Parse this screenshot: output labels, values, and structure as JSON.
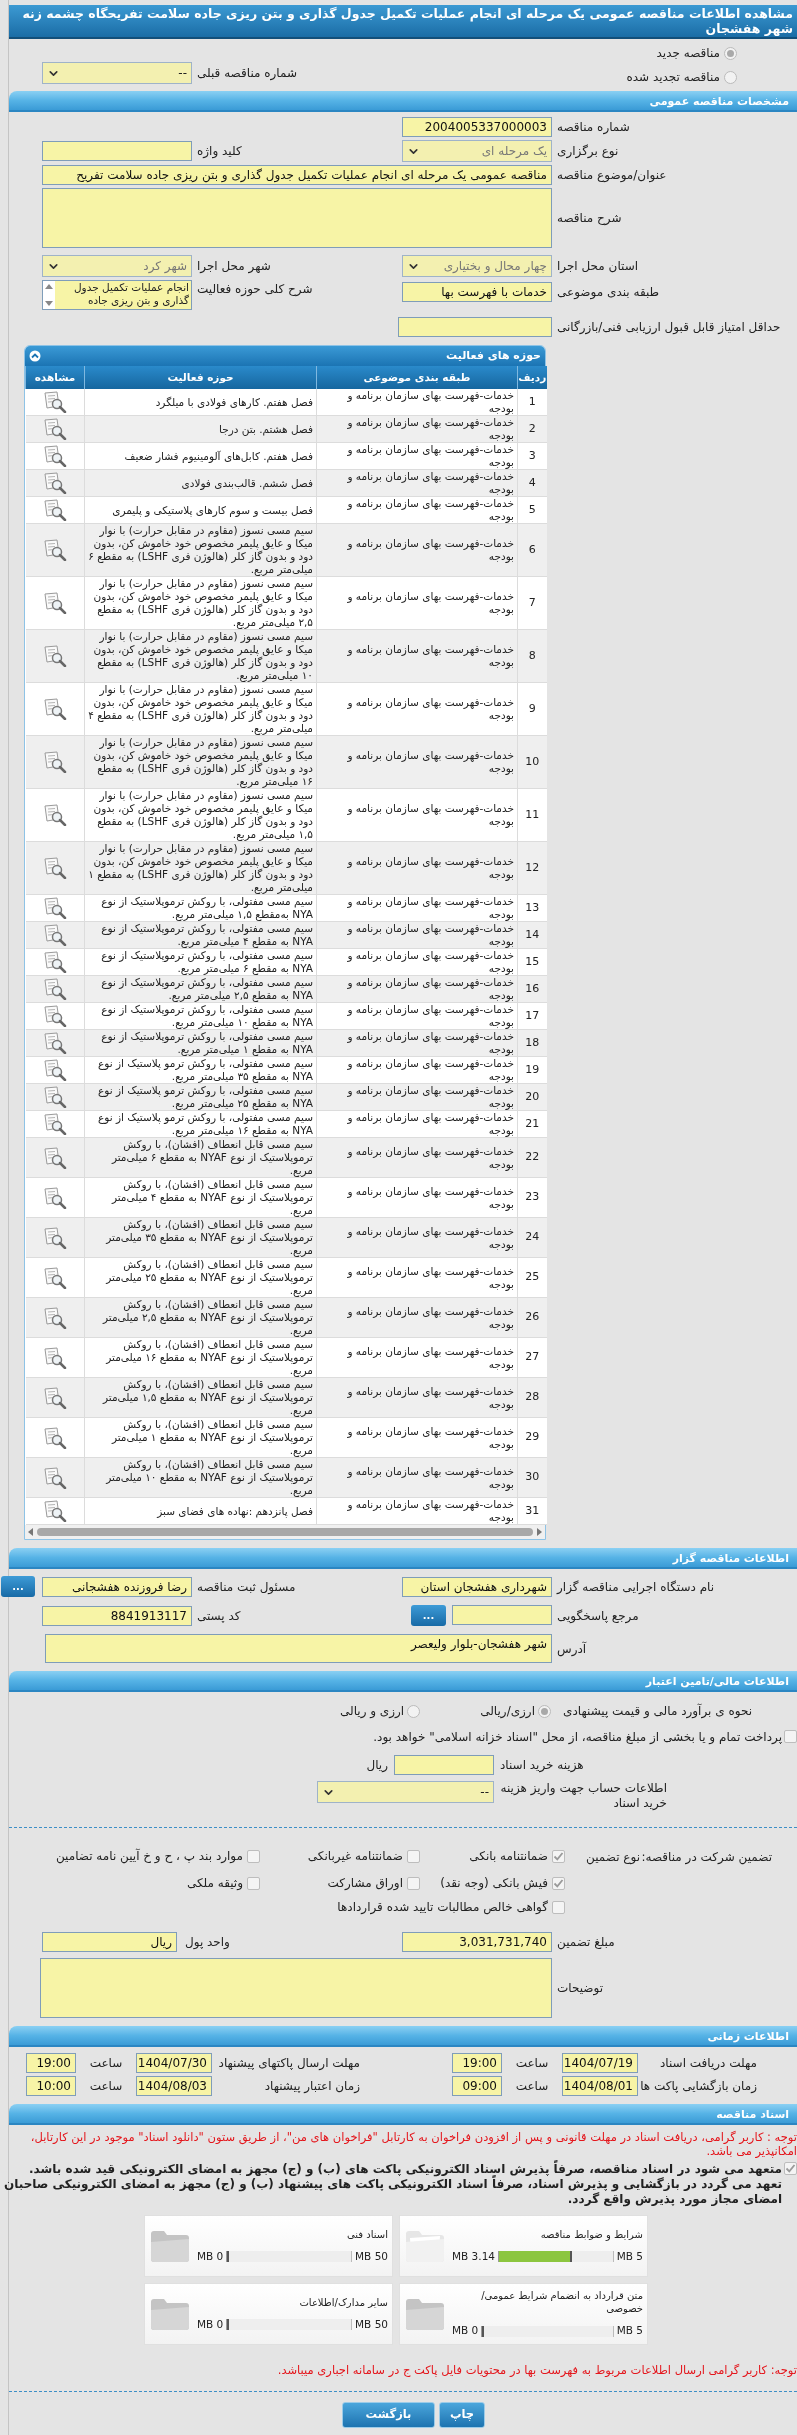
{
  "page_title": "مشاهده اطلاعات مناقصه عمومی یک مرحله ای انجام عملیات تکمیل جدول گذاری و بتن ریزی جاده سلامت تفریحگاه چشمه زنه شهر هفشجان",
  "tender_type": [
    {
      "label": "مناقصه جدید",
      "selected": true
    },
    {
      "label": "مناقصه تجدید شده",
      "selected": false
    }
  ],
  "previous_tender": {
    "label": "شماره مناقصه قبلی",
    "value": "--"
  },
  "general": {
    "header": "مشخصات مناقصه عمومی",
    "tender_number": {
      "label": "شماره مناقصه",
      "value": "2004005337000003"
    },
    "holding_type": {
      "label": "نوع برگزاری",
      "value": "یک مرحله ای",
      "disabled": true
    },
    "keyword": {
      "label": "کلید واژه"
    },
    "subject": {
      "label": "عنوان/موضوع مناقصه",
      "value": "مناقصه عمومی یک مرحله ای انجام عملیات تکمیل جدول گذاری و بتن ریزی جاده سلامت تفریح"
    },
    "description": {
      "label": "شرح مناقصه"
    },
    "province": {
      "label": "استان محل اجرا",
      "value": "چهار محال و بختیاری",
      "disabled": true
    },
    "city": {
      "label": "شهر محل اجرا",
      "value": "شهر کرد",
      "disabled": true
    },
    "category": {
      "label": "طبقه بندی موضوعی",
      "value": "خدمات با فهرست بها"
    },
    "activity_summary": {
      "label": "شرح کلی حوزه فعالیت",
      "value": "انجام عملیات تکمیل جدول گذاری و بتن ریزی جاده"
    },
    "min_score": {
      "label": "حداقل امتیاز قابل قبول ارزیابی فنی/بازرگانی"
    }
  },
  "activities": {
    "title": "حوزه های فعالیت",
    "columns": [
      "ردیف",
      "طبقه بندی موضوعی",
      "حوزه فعالیت",
      "مشاهده"
    ],
    "rows": [
      {
        "index": "1",
        "category": "خدمات-فهرست بهای سازمان برنامه و بودجه",
        "activity": "فصل هفتم. کارهای فولادی با میلگرد"
      },
      {
        "index": "2",
        "category": "خدمات-فهرست بهای سازمان برنامه و بودجه",
        "activity": "فصل هشتم. بتن درجا"
      },
      {
        "index": "3",
        "category": "خدمات-فهرست بهای سازمان برنامه و بودجه",
        "activity": "فصل هفتم. کابل‌های آلومینیوم فشار ضعیف"
      },
      {
        "index": "4",
        "category": "خدمات-فهرست بهای سازمان برنامه و بودجه",
        "activity": "فصل ششم. قالب‌بندی فولادی"
      },
      {
        "index": "5",
        "category": "خدمات-فهرست بهای سازمان برنامه و بودجه",
        "activity": "فصل بیست و سوم کارهای پلاستیکی و پلیمری"
      },
      {
        "index": "6",
        "category": "خدمات-فهرست بهای سازمان برنامه و بودجه",
        "activity": "سیم مسی نسوز (مقاوم در مقابل حرارت) با نوار میکا و عایق پلیمر مخصوص خود خاموش کن، بدون دود و بدون گاز کلر (هالوژن فری LSHF) به مقطع ۶ میلی‌متر مربع."
      },
      {
        "index": "7",
        "category": "خدمات-فهرست بهای سازمان برنامه و بودجه",
        "activity": "سیم مسی نسوز (مقاوم در مقابل حرارت) با نوار میکا و عایق پلیمر مخصوص خود خاموش کن، بدون دود و بدون گاز کلر (هالوژن فری LSHF) به مقطع ۲,۵ میلی‌متر مربع."
      },
      {
        "index": "8",
        "category": "خدمات-فهرست بهای سازمان برنامه و بودجه",
        "activity": "سیم مسی نسوز (مقاوم در مقابل حرارت) با نوار میکا و عایق پلیمر مخصوص خود خاموش کن، بدون دود و بدون گاز کلر (هالوژن فری LSHF) به مقطع ۱۰ میلی‌متر مربع."
      },
      {
        "index": "9",
        "category": "خدمات-فهرست بهای سازمان برنامه و بودجه",
        "activity": "سیم مسی نسوز (مقاوم در مقابل حرارت) با نوار میکا و عایق پلیمر مخصوص خود خاموش کن، بدون دود و بدون گاز کلر (هالوژن فری LSHF) به مقطع ۴ میلی‌متر مربع."
      },
      {
        "index": "10",
        "category": "خدمات-فهرست بهای سازمان برنامه و بودجه",
        "activity": "سیم مسی نسوز (مقاوم در مقابل حرارت) با نوار میکا و عایق پلیمر مخصوص خود خاموش کن، بدون دود و بدون گاز کلر (هالوژن فری LSHF) به مقطع ۱۶ میلی‌متر مربع."
      },
      {
        "index": "11",
        "category": "خدمات-فهرست بهای سازمان برنامه و بودجه",
        "activity": "سیم مسی نسوز (مقاوم در مقابل حرارت) با نوار میکا و عایق پلیمر مخصوص خود خاموش کن، بدون دود و بدون گاز کلر (هالوژن فری LSHF) به مقطع ۱,۵ میلی‌متر مربع."
      },
      {
        "index": "12",
        "category": "خدمات-فهرست بهای سازمان برنامه و بودجه",
        "activity": "سیم مسی نسوز (مقاوم در مقابل حرارت) با نوار میکا و عایق پلیمر مخصوص خود خاموش کن، بدون دود و بدون گاز کلر (هالوژن فری LSHF) به مقطع ۱ میلی‌متر مربع."
      },
      {
        "index": "13",
        "category": "خدمات-فهرست بهای سازمان برنامه و بودجه",
        "activity": "سیم مسی مفتولی، با روکش ترموپلاستیک از نوع NYA به‌مقطع ۱,۵ میلی‌متر مربع."
      },
      {
        "index": "14",
        "category": "خدمات-فهرست بهای سازمان برنامه و بودجه",
        "activity": "سیم مسی مفتولی، با روکش ترموپلاستیک از نوع NYA به مقطع ۴ میلی‌متر مربع."
      },
      {
        "index": "15",
        "category": "خدمات-فهرست بهای سازمان برنامه و بودجه",
        "activity": "سیم مسی مفتولی، با روکش ترموپلاستیک از نوع NYA به مقطع ۶ میلی‌متر مربع."
      },
      {
        "index": "16",
        "category": "خدمات-فهرست بهای سازمان برنامه و بودجه",
        "activity": "سیم مسی مفتولی، با روکش ترموپلاستیک از نوع NYA به مقطع ۲,۵ میلی‌متر مربع."
      },
      {
        "index": "17",
        "category": "خدمات-فهرست بهای سازمان برنامه و بودجه",
        "activity": "سیم مسی مفتولی، با روکش ترموپلاستیک از نوع NYA به مقطع ۱۰ میلی‌متر مربع."
      },
      {
        "index": "18",
        "category": "خدمات-فهرست بهای سازمان برنامه و بودجه",
        "activity": "سیم مسی مفتولی، با روکش ترموپلاستیک از نوع NYA به مقطع ۱ میلی‌متر مربع."
      },
      {
        "index": "19",
        "category": "خدمات-فهرست بهای سازمان برنامه و بودجه",
        "activity": "سیم مسی مفتولی، با روکش ترمو پلاستیک از نوع NYA به مقطع ۳۵ میلی‌متر مربع."
      },
      {
        "index": "20",
        "category": "خدمات-فهرست بهای سازمان برنامه و بودجه",
        "activity": "سیم مسی مفتولی، با روکش ترمو پلاستیک از نوع NYA به مقطع ۲۵ میلی‌متر مربع."
      },
      {
        "index": "21",
        "category": "خدمات-فهرست بهای سازمان برنامه و بودجه",
        "activity": "سیم مسی مفتولی، با روکش ترمو پلاستیک از نوع NYA به مقطع ۱۶ میلی‌متر مربع."
      },
      {
        "index": "22",
        "category": "خدمات-فهرست بهای سازمان برنامه و بودجه",
        "activity": "سیم مسی قابل انعطاف (افشان)، با روکش ترموپلاستیک از نوع NYAF به مقطع ۶ میلی‌متر مربع."
      },
      {
        "index": "23",
        "category": "خدمات-فهرست بهای سازمان برنامه و بودجه",
        "activity": "سیم مسی قابل انعطاف (افشان)، با روکش ترموپلاستیک از نوع NYAF به مقطع ۴ میلی‌متر مربع."
      },
      {
        "index": "24",
        "category": "خدمات-فهرست بهای سازمان برنامه و بودجه",
        "activity": "سیم مسی قابل انعطاف (افشان)، با روکش ترموپلاستیک از نوع NYAF به مقطع ۳۵ میلی‌متر مربع."
      },
      {
        "index": "25",
        "category": "خدمات-فهرست بهای سازمان برنامه و بودجه",
        "activity": "سیم مسی قابل انعطاف (افشان)، با روکش ترموپلاستیک از نوع NYAF به مقطع ۲۵ میلی‌متر مربع."
      },
      {
        "index": "26",
        "category": "خدمات-فهرست بهای سازمان برنامه و بودجه",
        "activity": "سیم مسی قابل انعطاف (افشان)، با روکش ترموپلاستیک از نوع NYAF به مقطع ۲,۵ میلی‌متر مربع."
      },
      {
        "index": "27",
        "category": "خدمات-فهرست بهای سازمان برنامه و بودجه",
        "activity": "سیم مسی قابل انعطاف (افشان)، با روکش ترموپلاستیک از نوع NYAF به مقطع ۱۶ میلی‌متر مربع."
      },
      {
        "index": "28",
        "category": "خدمات-فهرست بهای سازمان برنامه و بودجه",
        "activity": "سیم مسی قابل انعطاف (افشان)، با روکش ترموپلاستیک از نوع NYAF به مقطع ۱,۵ میلی‌متر مربع."
      },
      {
        "index": "29",
        "category": "خدمات-فهرست بهای سازمان برنامه و بودجه",
        "activity": "سیم مسی قابل انعطاف (افشان)، با روکش ترموپلاستیک از نوع NYAF به مقطع ۱ میلی‌متر مربع."
      },
      {
        "index": "30",
        "category": "خدمات-فهرست بهای سازمان برنامه و بودجه",
        "activity": "سیم مسی قابل انعطاف (افشان)، با روکش ترموپلاستیک از نوع NYAF به مقطع ۱۰ میلی‌متر مربع."
      },
      {
        "index": "31",
        "category": "خدمات-فهرست بهای سازمان برنامه و بودجه",
        "activity": "فصل پانزدهم :نهاده های فضای سبز"
      }
    ]
  },
  "organizer": {
    "header": "اطلاعات مناقصه گزار",
    "agency": {
      "label": "نام دستگاه اجرایی مناقصه گزار",
      "value": "شهرداری هفشجان استان"
    },
    "registrar": {
      "label": "مسئول ثبت مناقصه",
      "value": "رضا فروزنده هفشجانی",
      "button": "..."
    },
    "response_ref": {
      "label": "مرجع پاسخگویی",
      "button": "..."
    },
    "postal_code": {
      "label": "کد پستی",
      "value": "8841913117"
    },
    "address": {
      "label": "آدرس",
      "value": "شهر هفشجان-بلوار ولیعصر"
    }
  },
  "finance": {
    "header": "اطلاعات مالی/تامین اعتبار",
    "pricing": {
      "label": "نحوه ی برآورد مالی و قیمت پیشنهادی",
      "options": [
        {
          "label": "ارزی/ریالی",
          "selected": true
        },
        {
          "label": "ارزی و ریالی",
          "selected": false
        }
      ]
    },
    "treasury": {
      "label": "پرداخت تمام و یا بخشی از مبلغ مناقصه، از محل \"اسناد خزانه اسلامی\" خواهد بود.",
      "checked": false
    },
    "doc_fee": {
      "label": "هزینه خرید اسناد",
      "unit": "ریال"
    },
    "account": {
      "label": "اطلاعات حساب جهت واریز هزینه خرید اسناد",
      "value": "--"
    },
    "guarantee": {
      "label": "تضمین شرکت در مناقصه:",
      "type_label": "نوع تضمین",
      "options": [
        {
          "label": "ضمانتنامه بانکی",
          "checked": true
        },
        {
          "label": "ضمانتنامه غیربانکی",
          "checked": false
        },
        {
          "label": "موارد بند پ ، ح و خ آیین نامه تضامین",
          "checked": false
        },
        {
          "label": "فیش بانکی (وجه نقد)",
          "checked": true
        },
        {
          "label": "اوراق مشارکت",
          "checked": false
        },
        {
          "label": "وثیقه ملکی",
          "checked": false
        },
        {
          "label": "گواهی خالص مطالبات تایید شده قراردادها",
          "checked": false
        }
      ]
    },
    "amount": {
      "label": "مبلغ تضمین",
      "value": "3,031,731,740"
    },
    "currency": {
      "label": "واحد پول",
      "value": "ریال"
    },
    "notes": {
      "label": "توضیحات"
    }
  },
  "timing": {
    "header": "اطلاعات زمانی",
    "rows": [
      {
        "label": "مهلت دریافت اسناد",
        "date": "1404/07/19",
        "time_label": "ساعت",
        "time": "19:00"
      },
      {
        "label": "مهلت ارسال پاکتهای پیشنهاد",
        "date": "1404/07/30",
        "time_label": "ساعت",
        "time": "19:00"
      },
      {
        "label": "زمان بازگشایی پاکت ها",
        "date": "1404/08/01",
        "time_label": "ساعت",
        "time": "09:00"
      },
      {
        "label": "زمان اعتبار پیشنهاد",
        "date": "1404/08/03",
        "time_label": "ساعت",
        "time": "10:00"
      }
    ]
  },
  "documents": {
    "header": "اسناد مناقصه",
    "notice": "توجه : کاربر گرامی، دریافت اسناد در مهلت قانونی و پس از افزودن فراخوان به کارتابل \"فراخوان های من\"، از طریق ستون \"دانلود اسناد\" موجود در این کارتابل، امکانپذیر می باشد.",
    "commitment": {
      "text": "متعهد می شود در اسناد مناقصه، صرفاً پذیرش اسناد الکترونیکی پاکت های (ب) و (ج) مجهز به امضای الکترونیکی قید شده باشد. تعهد می گردد در بازگشایی و پذیرش اسناد، صرفاً اسناد الکترونیکی پاکت های پیشنهاد (ب) و (ج) مجهز به امضای الکترونیکی صاحبان امضای مجاز مورد پذیرش واقع گردد.",
      "checked": true
    },
    "files": [
      {
        "name": "شرایط و ضوابط مناقصه",
        "used": "3.14 MB",
        "max": "5 MB",
        "level": 0.628
      },
      {
        "name": "اسناد فنی",
        "used": "0 MB",
        "max": "50 MB",
        "level": 0
      },
      {
        "name": "متن قرارداد به انضمام شرایط عمومی/خصوصی",
        "used": "0 MB",
        "max": "5 MB",
        "level": 0
      },
      {
        "name": "سایر مدارک/اطلاعات",
        "used": "0 MB",
        "max": "50 MB",
        "level": 0
      }
    ],
    "footer_notice": "توجه: کاربر گرامی ارسال اطلاعات مربوط به فهرست بها در محتویات فایل پاکت ج در سامانه اجباری میباشد."
  },
  "buttons": [
    "چاپ",
    "بازگشت"
  ]
}
